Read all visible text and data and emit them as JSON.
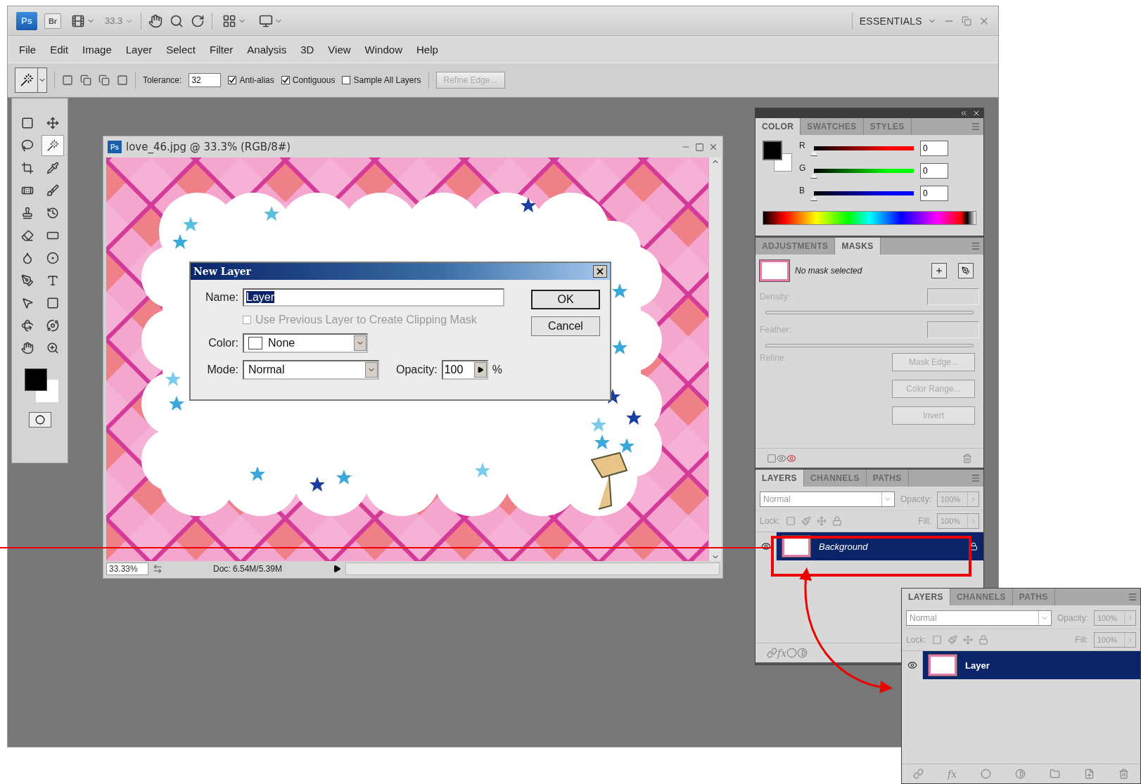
{
  "app_bar": {
    "logo": "Ps",
    "bridge": "Br",
    "zoom": "33.3",
    "workspace": "ESSENTIALS"
  },
  "menu": [
    "File",
    "Edit",
    "Image",
    "Layer",
    "Select",
    "Filter",
    "Analysis",
    "3D",
    "View",
    "Window",
    "Help"
  ],
  "options_bar": {
    "tolerance_label": "Tolerance:",
    "tolerance": "32",
    "checkboxes": [
      {
        "label": "Anti-alias",
        "checked": true
      },
      {
        "label": "Contiguous",
        "checked": true
      },
      {
        "label": "Sample All Layers",
        "checked": false
      }
    ],
    "refine_edge": "Refine Edge...",
    "refine_disabled": true
  },
  "toolbox": {
    "tools": [
      {
        "kind": "marquee",
        "selected": false
      },
      {
        "kind": "move",
        "selected": false
      },
      {
        "kind": "lasso",
        "selected": false
      },
      {
        "kind": "wand",
        "selected": true
      },
      {
        "kind": "crop",
        "selected": false
      },
      {
        "kind": "eyedropper",
        "selected": false
      },
      {
        "kind": "healing",
        "selected": false
      },
      {
        "kind": "brush",
        "selected": false
      },
      {
        "kind": "stamp",
        "selected": false
      },
      {
        "kind": "history",
        "selected": false
      },
      {
        "kind": "eraser",
        "selected": false
      },
      {
        "kind": "gradient",
        "selected": false
      },
      {
        "kind": "blur",
        "selected": false
      },
      {
        "kind": "dodge",
        "selected": false
      },
      {
        "kind": "pen",
        "selected": false
      },
      {
        "kind": "type",
        "selected": false
      },
      {
        "kind": "pointer",
        "selected": false
      },
      {
        "kind": "shape",
        "selected": false
      },
      {
        "kind": "rotate3d",
        "selected": false
      },
      {
        "kind": "orbit3d",
        "selected": false
      },
      {
        "kind": "hand",
        "selected": false
      },
      {
        "kind": "zoom",
        "selected": false
      }
    ]
  },
  "document": {
    "icon": "Ps",
    "title": "love_46.jpg @ 33.3% (RGB/8#)",
    "zoom": "33.33%",
    "doc_info": "Doc: 6.54M/5.39M"
  },
  "dialog": {
    "title": "New Layer",
    "name_label": "Name:",
    "name": "Layer",
    "name_highlighted": true,
    "clip_label": "Use Previous Layer to Create Clipping Mask",
    "clip_checked": false,
    "clip_disabled": true,
    "color_label": "Color:",
    "color_choice": "None",
    "mode_label": "Mode:",
    "mode": "Normal",
    "opacity_label": "Opacity:",
    "opacity": "100",
    "opacity_unit": "%",
    "buttons": [
      "OK",
      "Cancel"
    ]
  },
  "color_panel": {
    "tabs": [
      {
        "label": "COLOR",
        "selected": true
      },
      {
        "label": "SWATCHES",
        "selected": false
      },
      {
        "label": "STYLES",
        "selected": false
      }
    ],
    "channels": [
      {
        "label": "R",
        "value": "0",
        "level": 0,
        "color": "#ff0000"
      },
      {
        "label": "G",
        "value": "0",
        "level": 0,
        "color": "#00ff00"
      },
      {
        "label": "B",
        "value": "0",
        "level": 0,
        "color": "#0000ff"
      }
    ]
  },
  "masks_panel": {
    "tabs": [
      {
        "label": "ADJUSTMENTS",
        "selected": false
      },
      {
        "label": "MASKS",
        "selected": true
      }
    ],
    "status": "No mask selected",
    "density_label": "Density:",
    "feather_label": "Feather:",
    "refine_label": "Refine:",
    "buttons": [
      "Mask Edge...",
      "Color Range...",
      "Invert"
    ]
  },
  "layers_panel": {
    "tabs": [
      {
        "label": "LAYERS",
        "selected": true
      },
      {
        "label": "CHANNELS",
        "selected": false
      },
      {
        "label": "PATHS",
        "selected": false
      }
    ],
    "blend_mode": "Normal",
    "opacity_label": "Opacity:",
    "opacity": "100%",
    "lock_label": "Lock:",
    "fill_label": "Fill:",
    "fill": "100%",
    "fx_label": "fx",
    "layers": [
      {
        "name": "Background",
        "selected": true,
        "visible": true,
        "locked": true
      }
    ]
  },
  "callout_layers_panel": {
    "tabs": [
      {
        "label": "LAYERS",
        "selected": true
      },
      {
        "label": "CHANNELS",
        "selected": false
      },
      {
        "label": "PATHS",
        "selected": false
      }
    ],
    "blend_mode": "Normal",
    "opacity_label": "Opacity:",
    "opacity": "100%",
    "lock_label": "Lock:",
    "fill_label": "Fill:",
    "fill": "100%",
    "fx_label": "fx",
    "layers": [
      {
        "name": "Layer",
        "selected": true,
        "visible": true,
        "locked": false
      }
    ]
  }
}
